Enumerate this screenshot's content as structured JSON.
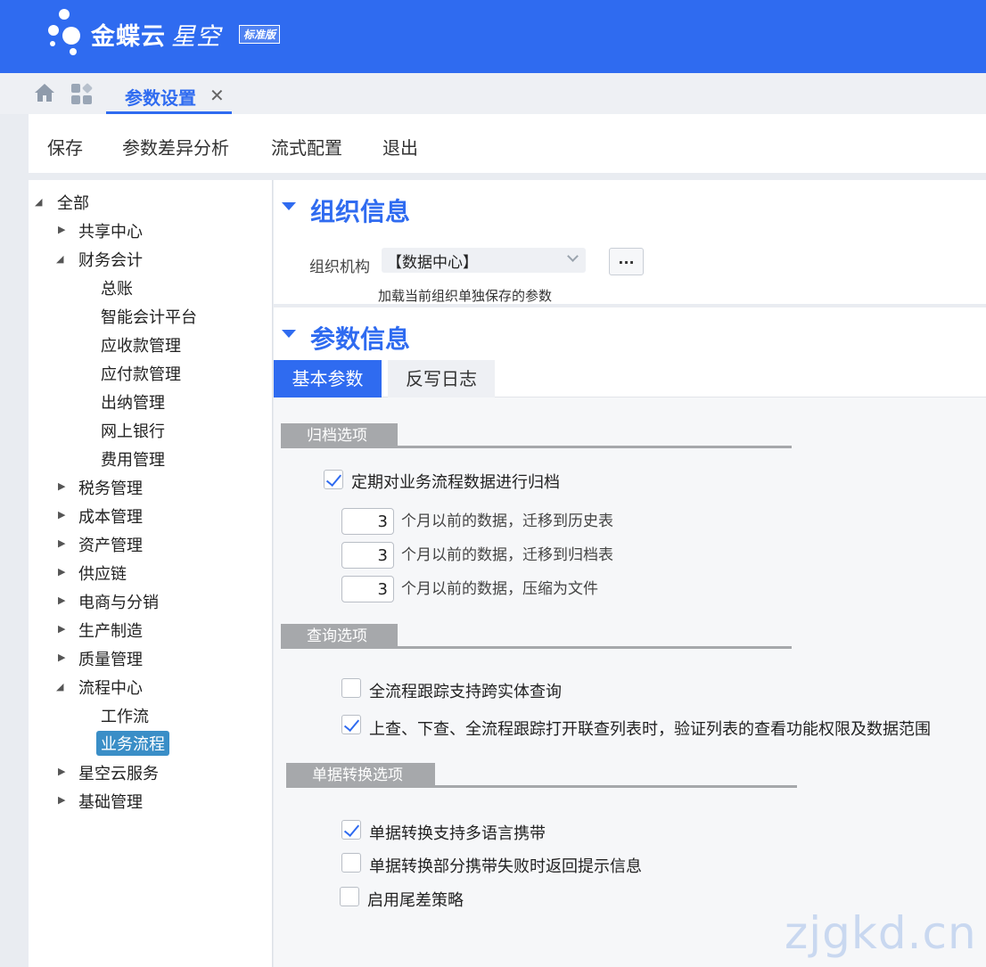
{
  "header": {
    "brand": "金蝶云",
    "product": "星空",
    "edition_badge": "标准版"
  },
  "tabs": {
    "active_tab": "参数设置",
    "close_glyph": "✕"
  },
  "toolbar": {
    "save": "保存",
    "diff_analysis": "参数差异分析",
    "flow_config": "流式配置",
    "exit": "退出"
  },
  "tree": {
    "root": "全部",
    "items": [
      {
        "label": "共享中心",
        "state": "collapsed"
      },
      {
        "label": "财务会计",
        "state": "expanded"
      },
      {
        "label": "总账"
      },
      {
        "label": "智能会计平台"
      },
      {
        "label": "应收款管理"
      },
      {
        "label": "应付款管理"
      },
      {
        "label": "出纳管理"
      },
      {
        "label": "网上银行"
      },
      {
        "label": "费用管理"
      },
      {
        "label": "税务管理",
        "state": "collapsed"
      },
      {
        "label": "成本管理",
        "state": "collapsed"
      },
      {
        "label": "资产管理",
        "state": "collapsed"
      },
      {
        "label": "供应链",
        "state": "collapsed"
      },
      {
        "label": "电商与分销",
        "state": "collapsed"
      },
      {
        "label": "生产制造",
        "state": "collapsed"
      },
      {
        "label": "质量管理",
        "state": "collapsed"
      },
      {
        "label": "流程中心",
        "state": "expanded"
      },
      {
        "label": "工作流"
      },
      {
        "label": "业务流程",
        "selected": true
      },
      {
        "label": "星空云服务",
        "state": "collapsed"
      },
      {
        "label": "基础管理",
        "state": "collapsed"
      }
    ]
  },
  "org_section": {
    "title": "组织信息",
    "org_label": "组织机构",
    "org_value": "【数据中心】",
    "more_button": "...",
    "hint": "加载当前组织单独保存的参数"
  },
  "param_section": {
    "title": "参数信息",
    "tabs": [
      "基本参数",
      "反写日志"
    ],
    "archive_group": {
      "title": "归档选项",
      "archive_enabled": {
        "label": "定期对业务流程数据进行归档",
        "checked": true
      },
      "rows": [
        {
          "value": "3",
          "label": "个月以前的数据，迁移到历史表"
        },
        {
          "value": "3",
          "label": "个月以前的数据，迁移到归档表"
        },
        {
          "value": "3",
          "label": "个月以前的数据，压缩为文件"
        }
      ]
    },
    "query_group": {
      "title": "查询选项",
      "options": [
        {
          "label": "全流程跟踪支持跨实体查询",
          "checked": false
        },
        {
          "label": "上查、下查、全流程跟踪打开联查列表时，验证列表的查看功能权限及数据范围",
          "checked": true
        }
      ]
    },
    "convert_group": {
      "title": "单据转换选项",
      "options": [
        {
          "label": "单据转换支持多语言携带",
          "checked": true
        },
        {
          "label": "单据转换部分携带失败时返回提示信息",
          "checked": false
        },
        {
          "label": "启用尾差策略",
          "checked": false
        }
      ]
    }
  },
  "watermark": "zjgkd.cn",
  "colors": {
    "brand_blue": "#2f6bf0",
    "tree_selected": "#3a8ec7",
    "group_header_gray": "#a6a8ab"
  }
}
